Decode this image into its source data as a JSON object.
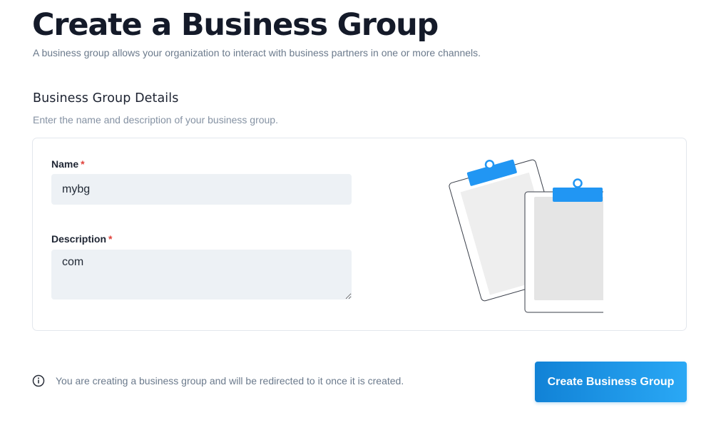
{
  "header": {
    "title": "Create a Business Group",
    "subtitle": "A business group allows your organization to interact with business partners in one or more channels."
  },
  "details": {
    "title": "Business Group Details",
    "subtitle": "Enter the name and description of your business group."
  },
  "form": {
    "name": {
      "label": "Name",
      "required_mark": "*",
      "value": "mybg"
    },
    "description": {
      "label": "Description",
      "required_mark": "*",
      "value": "com"
    }
  },
  "footer": {
    "info_icon": "info-circle-icon",
    "info_text": "You are creating a business group and will be redirected to it once it is created.",
    "create_button_label": "Create Business Group"
  },
  "illustration": {
    "icon": "clipboards-illustration"
  },
  "colors": {
    "title": "#141a29",
    "muted_text": "#6b7a8c",
    "required": "#e0413a",
    "input_background": "#edf1f5",
    "accent_start": "#1182d6",
    "accent_end": "#2aa8f5",
    "clip_blue": "#2196f3"
  }
}
